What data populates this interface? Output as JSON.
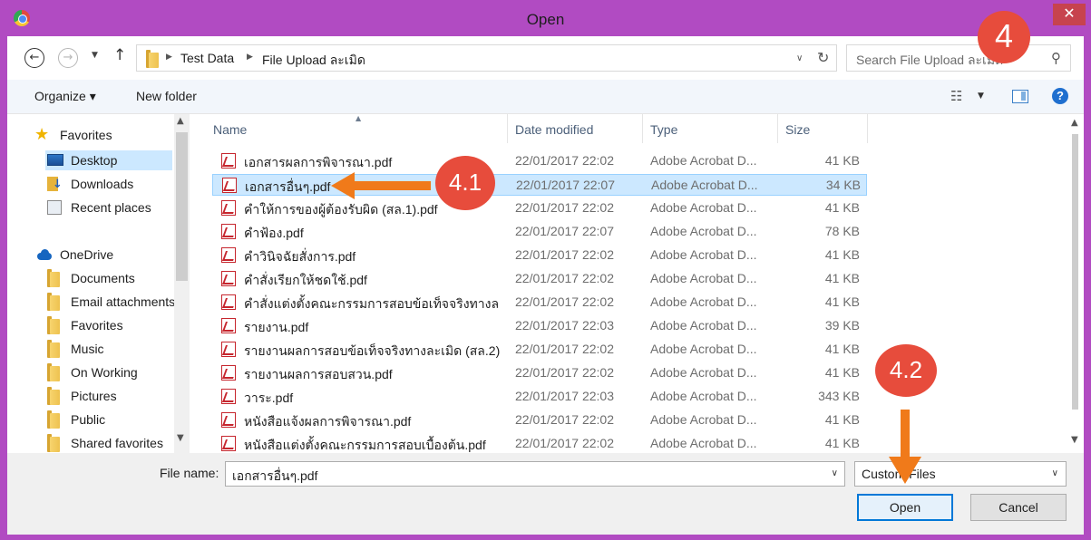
{
  "window": {
    "title": "Open",
    "close_glyph": "✕"
  },
  "address_bar": {
    "back_glyph": "←",
    "forward_glyph": "→",
    "history_glyph": "▼",
    "up_glyph": "↑",
    "crumbs": [
      "Test Data",
      "File Upload ละเมิด"
    ],
    "crumb_sep": "▶",
    "dropdown_glyph": "∨",
    "refresh_glyph": "↻"
  },
  "search": {
    "placeholder": "Search File Upload ละเมิด",
    "icon_glyph": "⚲"
  },
  "toolbar": {
    "organize_label": "Organize ▾",
    "new_folder_label": "New folder",
    "view_glyph": "☷",
    "view_dd_glyph": "▼",
    "help_glyph": "?"
  },
  "nav_pane": {
    "favorites_header": "Favorites",
    "favorites": [
      "Desktop",
      "Downloads",
      "Recent places"
    ],
    "onedrive_header": "OneDrive",
    "onedrive_items": [
      "Documents",
      "Email attachments",
      "Favorites",
      "Music",
      "On Working",
      "Pictures",
      "Public",
      "Shared favorites"
    ],
    "scroll_up": "▲",
    "scroll_down": "▼"
  },
  "file_list": {
    "columns": {
      "name": "Name",
      "date": "Date modified",
      "type": "Type",
      "size": "Size"
    },
    "sort_glyph": "▲",
    "rows": [
      {
        "name": "เอกสารผลการพิจารณา.pdf",
        "date": "22/01/2017 22:02",
        "type": "Adobe Acrobat D...",
        "size": "41 KB"
      },
      {
        "name": "เอกสารอื่นๆ.pdf",
        "date": "22/01/2017 22:07",
        "type": "Adobe Acrobat D...",
        "size": "34 KB"
      },
      {
        "name": "คำให้การของผู้ต้องรับผิด (สล.1).pdf",
        "date": "22/01/2017 22:02",
        "type": "Adobe Acrobat D...",
        "size": "41 KB"
      },
      {
        "name": "คำฟ้อง.pdf",
        "date": "22/01/2017 22:07",
        "type": "Adobe Acrobat D...",
        "size": "78 KB"
      },
      {
        "name": "คำวินิจฉัยสั่งการ.pdf",
        "date": "22/01/2017 22:02",
        "type": "Adobe Acrobat D...",
        "size": "41 KB"
      },
      {
        "name": "คำสั่งเรียกให้ชดใช้.pdf",
        "date": "22/01/2017 22:02",
        "type": "Adobe Acrobat D...",
        "size": "41 KB"
      },
      {
        "name": "คำสั่งแต่งตั้งคณะกรรมการสอบข้อเท็จจริงทางละเม...",
        "date": "22/01/2017 22:02",
        "type": "Adobe Acrobat D...",
        "size": "41 KB"
      },
      {
        "name": "รายงาน.pdf",
        "date": "22/01/2017 22:03",
        "type": "Adobe Acrobat D...",
        "size": "39 KB"
      },
      {
        "name": "รายงานผลการสอบข้อเท็จจริงทางละเมิด (สล.2).pdf",
        "date": "22/01/2017 22:02",
        "type": "Adobe Acrobat D...",
        "size": "41 KB"
      },
      {
        "name": "รายงานผลการสอบสวน.pdf",
        "date": "22/01/2017 22:02",
        "type": "Adobe Acrobat D...",
        "size": "41 KB"
      },
      {
        "name": "วาระ.pdf",
        "date": "22/01/2017 22:03",
        "type": "Adobe Acrobat D...",
        "size": "343 KB"
      },
      {
        "name": "หนังสือแจ้งผลการพิจารณา.pdf",
        "date": "22/01/2017 22:02",
        "type": "Adobe Acrobat D...",
        "size": "41 KB"
      },
      {
        "name": "หนังสือแต่งตั้งคณะกรรมการสอบเบื้องต้น.pdf",
        "date": "22/01/2017 22:02",
        "type": "Adobe Acrobat D...",
        "size": "41 KB"
      }
    ],
    "selected_index": 1,
    "scroll_up": "▲",
    "scroll_down": "▼"
  },
  "bottom": {
    "file_name_label": "File name:",
    "file_name_value": "เอกสารอื่นๆ.pdf",
    "dropdown_glyph": "∨",
    "filter_value": "Custom Files",
    "open_label": "Open",
    "cancel_label": "Cancel"
  },
  "annotations": {
    "step_4": "4",
    "step_4_1": "4.1",
    "step_4_2": "4.2",
    "color": "#e74c3c",
    "arrow_color": "#f07a1a"
  }
}
